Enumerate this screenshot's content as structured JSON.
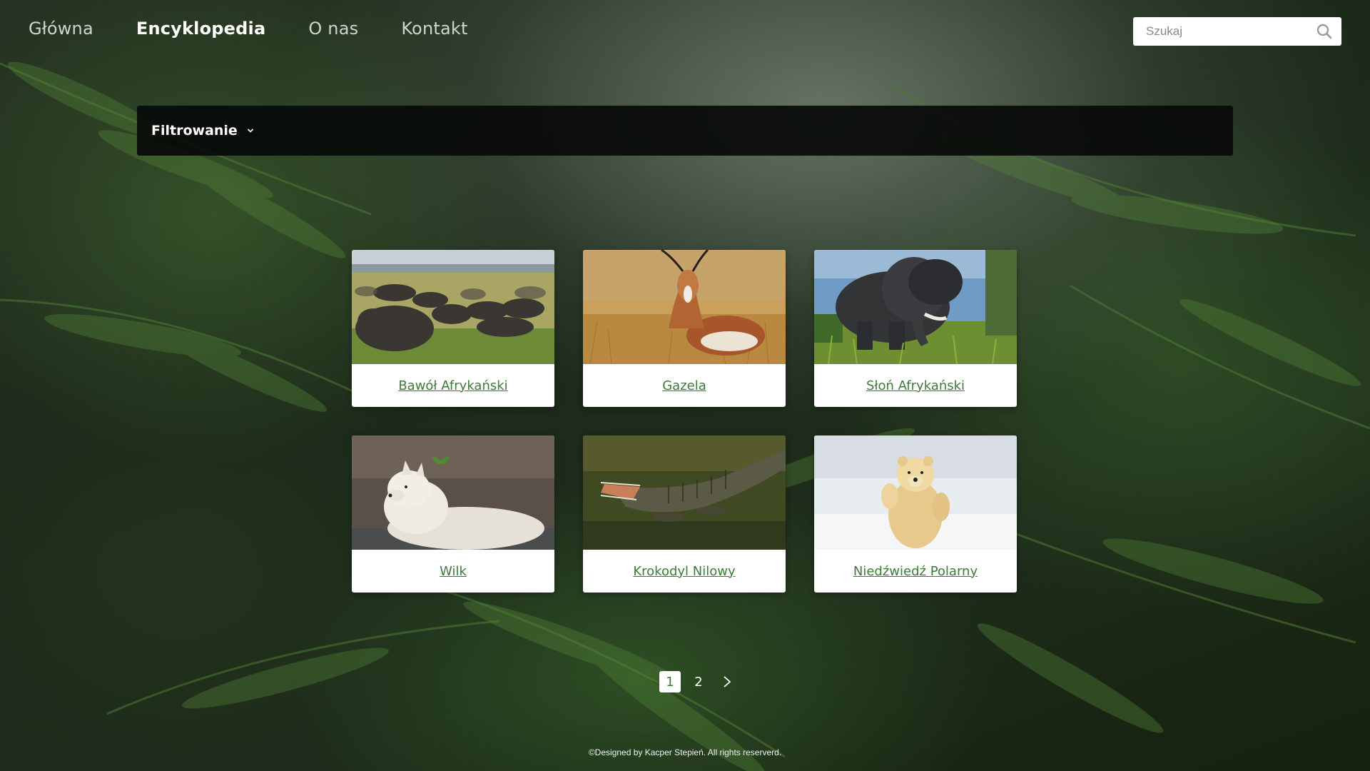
{
  "nav": {
    "items": [
      {
        "label": "Główna",
        "active": false
      },
      {
        "label": "Encyklopedia",
        "active": true
      },
      {
        "label": "O nas",
        "active": false
      },
      {
        "label": "Kontakt",
        "active": false
      }
    ]
  },
  "search": {
    "placeholder": "Szukaj",
    "value": "",
    "icon": "search-icon"
  },
  "filter": {
    "label": "Filtrowanie",
    "icon": "chevron-down-icon"
  },
  "animals": [
    {
      "name": "Bawół Afrykański"
    },
    {
      "name": "Gazela"
    },
    {
      "name": "Słoń Afrykański"
    },
    {
      "name": "Wilk"
    },
    {
      "name": "Krokodyl Nilowy"
    },
    {
      "name": "Niedźwiedź Polarny"
    }
  ],
  "pagination": {
    "pages": [
      "1",
      "2"
    ],
    "current": "1",
    "next_icon": "chevron-right-icon"
  },
  "footer": {
    "text": "©Designed by Kacper Stepień. All rights reserverd."
  },
  "colors": {
    "link": "#3e7a3a",
    "filter_bar": "#080a08",
    "background": "#1e2d1b"
  }
}
